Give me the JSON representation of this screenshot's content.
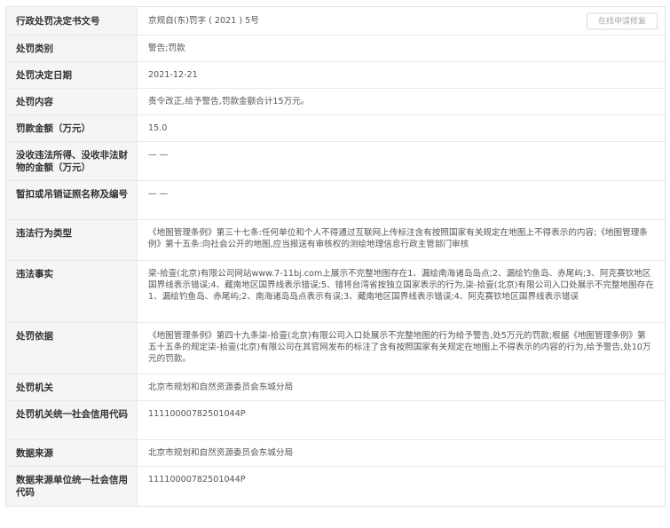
{
  "rows": [
    {
      "label": "行政处罚决定书文号",
      "value": "京规自(东)罚字 ( 2021 ) 5号",
      "button": "在线申请修复"
    },
    {
      "label": "处罚类别",
      "value": "警告;罚款"
    },
    {
      "label": "处罚决定日期",
      "value": "2021-12-21"
    },
    {
      "label": "处罚内容",
      "value": "责令改正,给予警告,罚款金额合计15万元。"
    },
    {
      "label": "罚款金额（万元）",
      "value": "15.0"
    },
    {
      "label": "没收违法所得、没收非法财物的金额（万元）",
      "value": "— —"
    },
    {
      "label": "暂扣或吊销证照名称及编号",
      "value": "— —"
    },
    {
      "label": "违法行为类型",
      "value": "《地图管理条例》第三十七条:任何单位和个人不得通过互联网上传标注含有按照国家有关规定在地图上不得表示的内容;《地图管理条例》第十五条:向社会公开的地图,应当报送有审核权的测绘地理信息行政主管部门审核"
    },
    {
      "label": "违法事实",
      "value": "梁-拾壹(北京)有限公司网站www.7-11bj.com上展示不完整地图存在1、漏绘南海诸岛岛点;2、漏绘钓鱼岛、赤尾屿;3、阿克赛钦地区国界线表示错误;4、藏南地区国界线表示错误;5、错将台湾省按独立国家表示的行为,柒-拾壹(北京)有限公司入口处展示不完整地图存在1、漏绘钓鱼岛、赤尾屿;2、南海诸岛岛点表示有误;3、藏南地区国界线表示错误;4、阿克赛钦地区国界线表示错误"
    },
    {
      "label": "处罚依据",
      "value": "《地图管理条例》第四十九条柒-拾壹(北京)有限公司入口处展示不完整地图的行为给予警告,处5万元的罚款;根据《地图管理条例》第五十五条的规定柒-拾壹(北京)有限公司在其官网发布的标注了含有按照国家有关规定在地图上不得表示的内容的行为,给予警告,处10万元的罚款。"
    },
    {
      "label": "处罚机关",
      "value": "北京市规划和自然资源委员会东城分局"
    },
    {
      "label": "处罚机关统一社会信用代码",
      "value": "11110000782501044P"
    },
    {
      "label": "数据来源",
      "value": "北京市规划和自然资源委员会东城分局"
    },
    {
      "label": "数据来源单位统一社会信用代码",
      "value": "11110000782501044P"
    }
  ]
}
